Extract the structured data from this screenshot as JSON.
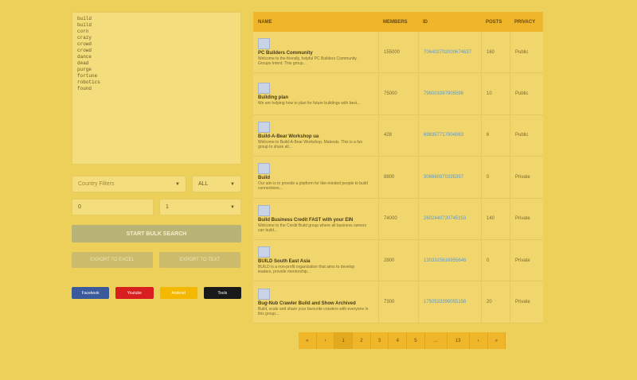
{
  "keywords": [
    "build",
    "build",
    "corn",
    "crazy",
    "crowd",
    "crowd",
    "dance",
    "dead",
    "purge",
    "fortune",
    "robotics",
    "found"
  ],
  "filters": {
    "country_placeholder": "Country Filters",
    "type_value": "ALL",
    "min_value": "0",
    "max_value": "1"
  },
  "actions": {
    "start_label": "START BULK SEARCH",
    "export_excel": "EXPORT TO EXCEL",
    "export_text": "EXPORT TO TEXT"
  },
  "social": [
    {
      "label": "Facebook",
      "color": "#3b5a9a"
    },
    {
      "label": "Youtube",
      "color": "#d81e1e"
    },
    {
      "label": "Android",
      "color": "#f5b800"
    },
    {
      "label": "Tools",
      "color": "#1a1a1a"
    }
  ],
  "table": {
    "headers": [
      "NAME",
      "MEMBERS",
      "ID",
      "POSTS",
      "PRIVACY"
    ],
    "rows": [
      {
        "name": "PC Builders Community",
        "desc": "Welcome to the friendly, helpful PC Builders Community. Groups Intent: This group...",
        "members": "155000",
        "id": "706402702000674637",
        "posts": "160",
        "privacy": "Public"
      },
      {
        "name": "Building plan",
        "desc": "We are helping how to plan for future buildings with best...",
        "members": "75000",
        "id": "796003397905596",
        "posts": "10",
        "privacy": "Public"
      },
      {
        "name": "Build-A-Bear Workshop ua",
        "desc": "Welcome to Build-A-Bear Workshop, Makeuts. This is a fun group to share all...",
        "members": "428",
        "id": "698357717904063",
        "posts": "6",
        "privacy": "Public"
      },
      {
        "name": "Build",
        "desc": "Our aim is to provide a platform for like-minded people to build connections...",
        "members": "8800",
        "id": "306660970395397",
        "posts": "0",
        "privacy": "Private"
      },
      {
        "name": "Build Business Credit FAST with your EIN",
        "desc": "Welcome to the Credit Build group where all business owners can build...",
        "members": "74000",
        "id": "2602440720745153",
        "posts": "140",
        "privacy": "Private"
      },
      {
        "name": "BUILD South East Asia",
        "desc": "BUILD is a non-profit organization that aims to develop leaders, provide mentorship...",
        "members": "2800",
        "id": "1303315616955646",
        "posts": "0",
        "privacy": "Private"
      },
      {
        "name": "Bug-Nub Crawler Build and Show Archived",
        "desc": "Build, scale and share your favourite crawlers with everyone in this group...",
        "members": "7300",
        "id": "1750533399055156",
        "posts": "20",
        "privacy": "Private"
      }
    ]
  },
  "pagination": [
    "«",
    "‹",
    "1",
    "2",
    "3",
    "4",
    "5",
    "...",
    "13",
    "›",
    "»"
  ]
}
